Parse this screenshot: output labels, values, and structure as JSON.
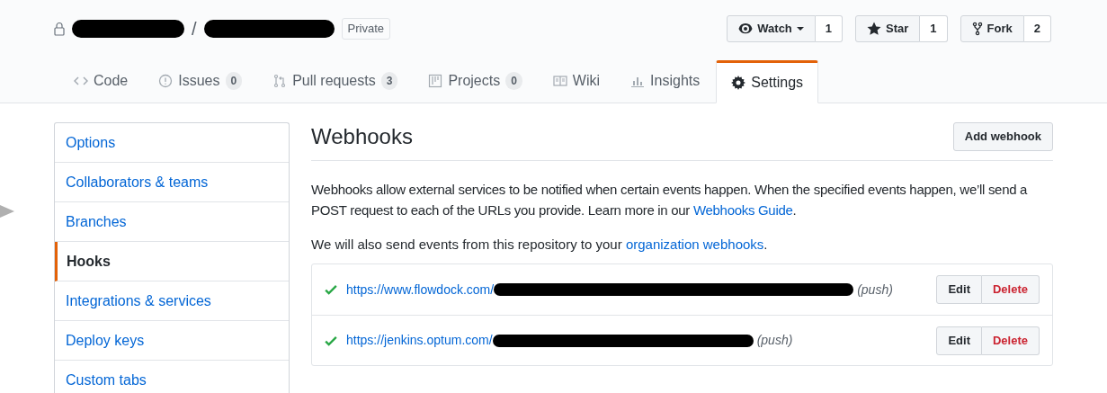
{
  "repo": {
    "separator": "/",
    "visibility": "Private"
  },
  "actions": [
    {
      "kind": "watch",
      "label": "Watch",
      "count": "1"
    },
    {
      "kind": "star",
      "label": "Star",
      "count": "1"
    },
    {
      "kind": "fork",
      "label": "Fork",
      "count": "2"
    }
  ],
  "tabs": [
    {
      "kind": "code",
      "label": "Code",
      "selected": false
    },
    {
      "kind": "issues",
      "label": "Issues",
      "counter": "0",
      "selected": false
    },
    {
      "kind": "pulls",
      "label": "Pull requests",
      "counter": "3",
      "selected": false
    },
    {
      "kind": "projects",
      "label": "Projects",
      "counter": "0",
      "selected": false
    },
    {
      "kind": "wiki",
      "label": "Wiki",
      "selected": false
    },
    {
      "kind": "insights",
      "label": "Insights",
      "selected": false
    },
    {
      "kind": "settings",
      "label": "Settings",
      "selected": true
    }
  ],
  "sidebar": {
    "items": [
      {
        "label": "Options",
        "selected": false
      },
      {
        "label": "Collaborators & teams",
        "selected": false
      },
      {
        "label": "Branches",
        "selected": false
      },
      {
        "label": "Hooks",
        "selected": true
      },
      {
        "label": "Integrations & services",
        "selected": false
      },
      {
        "label": "Deploy keys",
        "selected": false
      },
      {
        "label": "Custom tabs",
        "selected": false
      }
    ]
  },
  "main": {
    "title": "Webhooks",
    "add_button": "Add webhook",
    "intro": "Webhooks allow external services to be notified when certain events happen. When the specified events happen, we’ll send a POST request to each of the URLs you provide. Learn more in our",
    "intro_link": "Webhooks Guide",
    "intro_end": ".",
    "note": "We will also send events from this repository to your",
    "note_link": "organization webhooks",
    "note_end": ".",
    "hooks": [
      {
        "url": "https://www.flowdock.com/",
        "events": "(push)",
        "edit": "Edit",
        "delete": "Delete"
      },
      {
        "url": "https://jenkins.optum.com/",
        "events": "(push)",
        "edit": "Edit",
        "delete": "Delete"
      }
    ]
  }
}
